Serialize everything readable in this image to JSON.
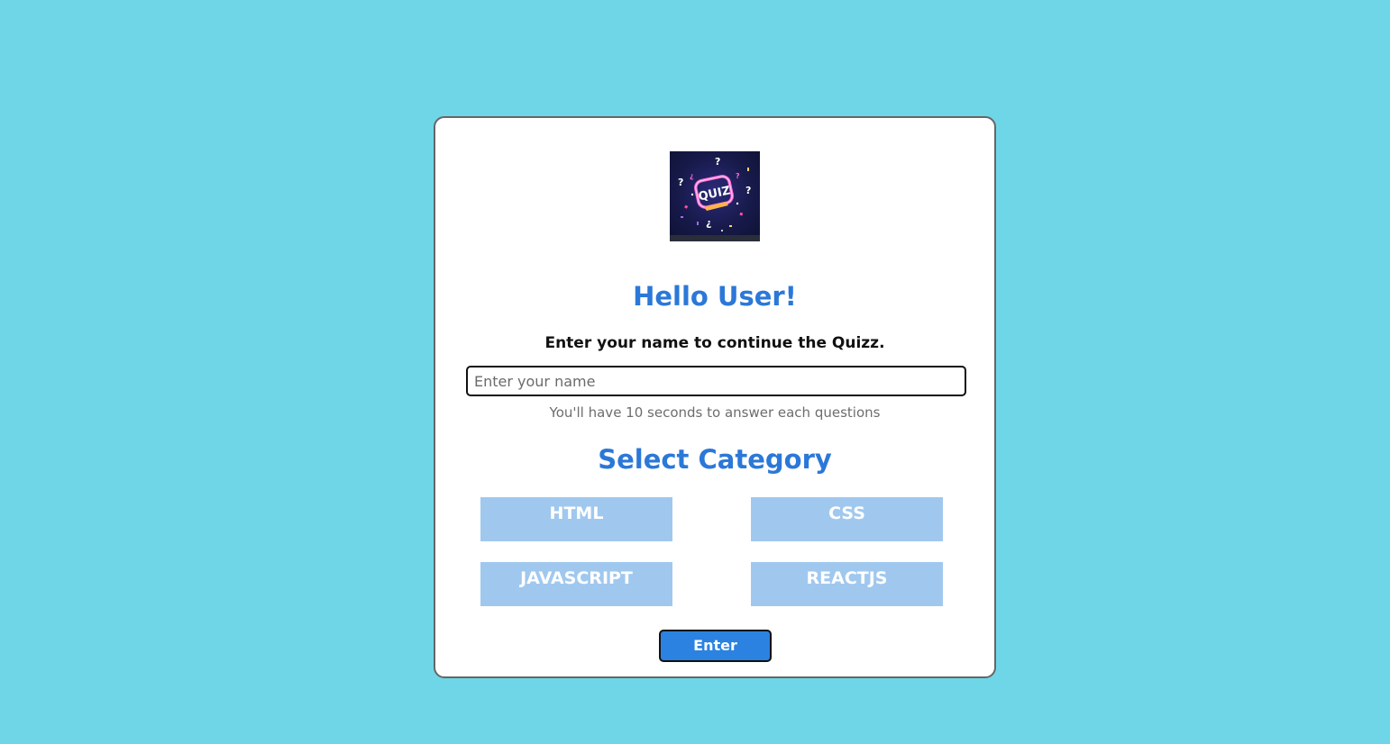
{
  "logo": {
    "text": "QUIZ",
    "icon": "quiz-logo-icon"
  },
  "greeting": "Hello User!",
  "instruction": "Enter your name to continue the Quizz.",
  "name_input": {
    "placeholder": "Enter your name",
    "value": ""
  },
  "hint": "You'll have 10 seconds to answer each questions",
  "category_title": "Select Category",
  "categories": [
    {
      "label": "HTML"
    },
    {
      "label": "CSS"
    },
    {
      "label": "JAVASCRIPT"
    },
    {
      "label": "REACTJS"
    }
  ],
  "enter_label": "Enter",
  "colors": {
    "background": "#6fd6e7",
    "accent": "#2b78d8",
    "category_bg": "#a0c8ef",
    "button_bg": "#2b82e0"
  }
}
